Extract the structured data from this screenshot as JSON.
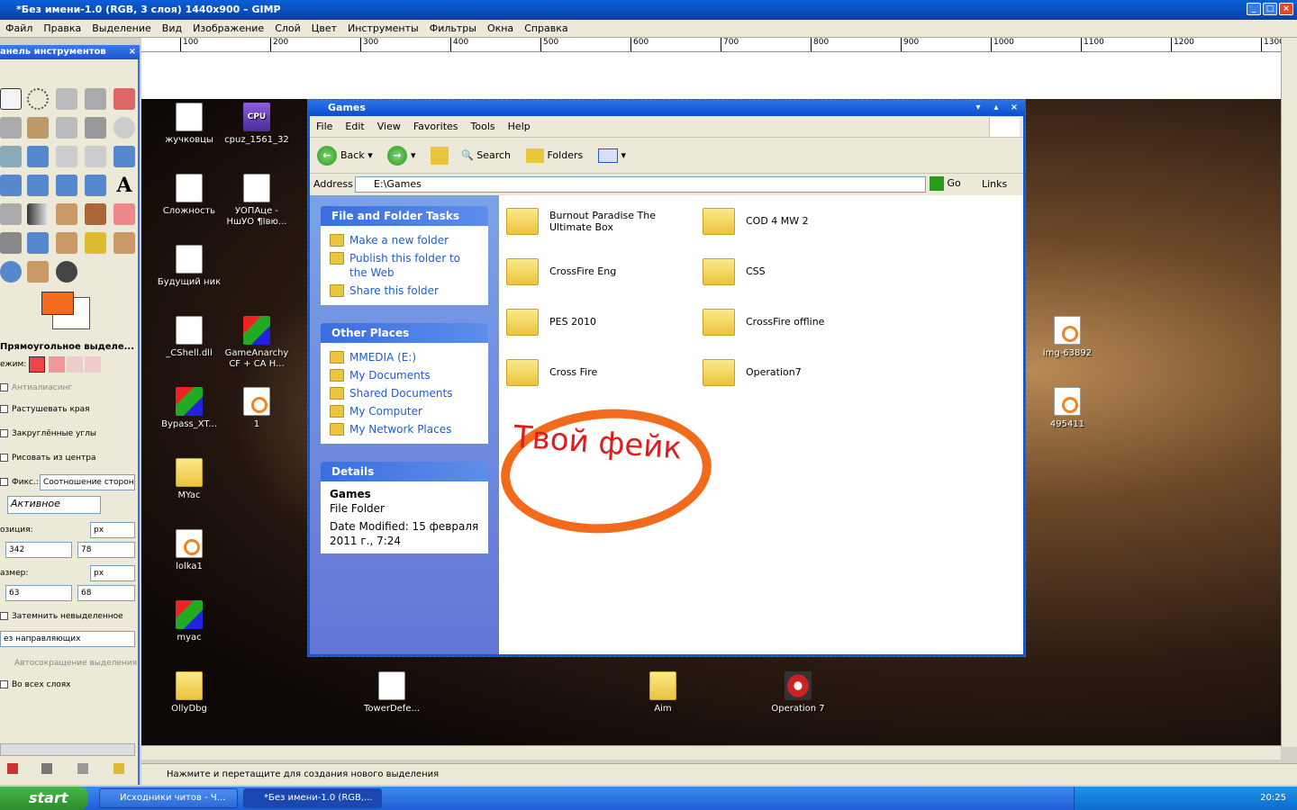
{
  "gimp": {
    "title": "*Без имени-1.0 (RGB, 3 слоя) 1440x900 – GIMP",
    "menu": [
      "Файл",
      "Правка",
      "Выделение",
      "Вид",
      "Изображение",
      "Слой",
      "Цвет",
      "Инструменты",
      "Фильтры",
      "Окна",
      "Справка"
    ],
    "ruler": [
      "100",
      "200",
      "300",
      "400",
      "500",
      "600",
      "700",
      "800",
      "900",
      "1000",
      "1100",
      "1200",
      "1300"
    ],
    "status": "Нажмите и перетащите для создания нового выделения"
  },
  "toolbox": {
    "title": "анель инструментов",
    "tool_options_title": "Прямоугольное выделе...",
    "mode_label": "ежим:",
    "antialias": "Антиалиасинг",
    "feather": "Растушевать края",
    "rounded": "Закруглённые углы",
    "expand_center": "Рисовать из центра",
    "fixed_label": "Фикс.:",
    "fixed_value": "Соотношение сторон",
    "fixed_input": "Активное",
    "position_label": "озиция:",
    "position_unit": "px",
    "pos_x": "342",
    "pos_y": "78",
    "size_label": "азмер:",
    "size_unit": "px",
    "size_w": "63",
    "size_h": "68",
    "highlight": "Затемнить невыделенное",
    "guides": "ез направляющих",
    "autoshrink": "Автосокращение выделения",
    "all_layers": "Во всех слоях"
  },
  "desktop_icons": [
    {
      "label": "жучковцы",
      "type": "doc"
    },
    {
      "label": "cpuz_1561_32",
      "type": "cpu"
    },
    {
      "label": "Сложность",
      "type": "doc"
    },
    {
      "label": "УОПАце - НшУО ¶Івю...",
      "type": "doc"
    },
    {
      "label": "Будущий ник",
      "type": "doc"
    },
    {
      "label": "_CShell.dll",
      "type": "doc"
    },
    {
      "label": "GameAnarchy CF + CA H...",
      "type": "rar"
    },
    {
      "label": "Bypass_XT...",
      "type": "rar"
    },
    {
      "label": "1",
      "type": "jpg"
    },
    {
      "label": "MYac",
      "type": "fold"
    },
    {
      "label": "lolka1",
      "type": "jpg"
    },
    {
      "label": "myac",
      "type": "rar"
    },
    {
      "label": "OllyDbg",
      "type": "fold"
    },
    {
      "label": "TowerDefe...",
      "type": "doc"
    },
    {
      "label": "Aim",
      "type": "fold"
    },
    {
      "label": "Operation 7",
      "type": "red"
    },
    {
      "label": "img-63892",
      "type": "jpg"
    },
    {
      "label": "495411",
      "type": "jpg"
    }
  ],
  "explorer": {
    "title": "Games",
    "menu": [
      "File",
      "Edit",
      "View",
      "Favorites",
      "Tools",
      "Help"
    ],
    "back": "Back",
    "search": "Search",
    "folders": "Folders",
    "address_label": "Address",
    "address": "E:\\Games",
    "go": "Go",
    "links": "Links",
    "tasks_title": "File and Folder Tasks",
    "tasks": [
      "Make a new folder",
      "Publish this folder to the Web",
      "Share this folder"
    ],
    "places_title": "Other Places",
    "places": [
      "MMEDIA (E:)",
      "My Documents",
      "Shared Documents",
      "My Computer",
      "My Network Places"
    ],
    "details_title": "Details",
    "details_name": "Games",
    "details_type": "File Folder",
    "details_modified": "Date Modified: 15 февраля 2011 г., 7:24",
    "folders_list": [
      "Burnout Paradise The Ultimate Box",
      "COD 4 MW 2",
      "CrossFire Eng",
      "CSS",
      "PES 2010",
      "CrossFire offline",
      "Cross Fire",
      "Operation7"
    ]
  },
  "annotation": "Твой фейк",
  "taskbar": {
    "start": "start",
    "tasks": [
      "Исходники читов - Ч...",
      "*Без имени-1.0 (RGB,..."
    ],
    "clock": "20:25"
  },
  "colors": {
    "fg": "#f26a1b",
    "annotation_text": "#e21c1c"
  }
}
